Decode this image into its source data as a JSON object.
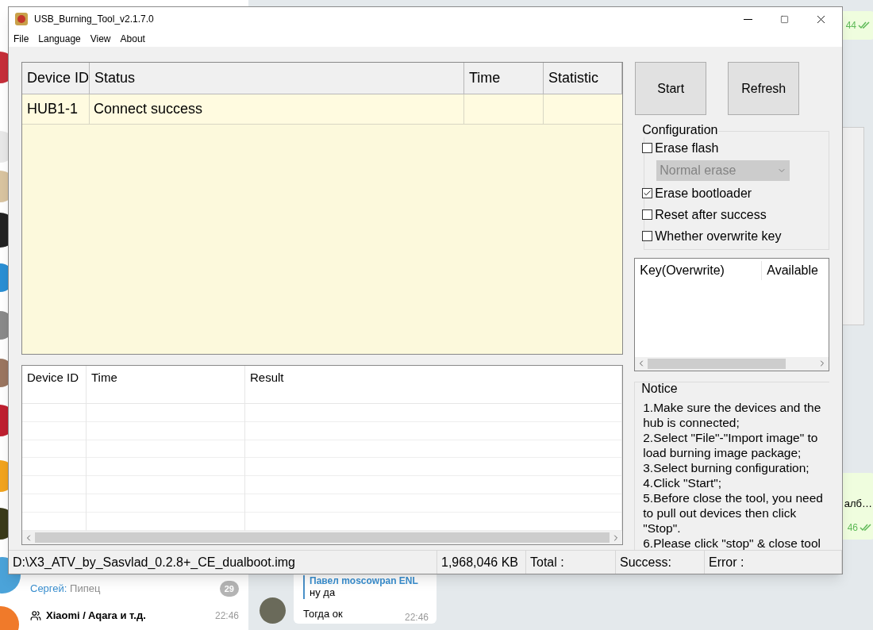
{
  "window": {
    "title": "USB_Burning_Tool_v2.1.7.0"
  },
  "menu": [
    "File",
    "Language",
    "View",
    "About"
  ],
  "device_table": {
    "columns": [
      "Device ID",
      "Status",
      "Time",
      "Statistic"
    ],
    "rows": [
      {
        "device_id": "HUB1-1",
        "status": "Connect success"
      }
    ]
  },
  "result_table": {
    "columns": [
      "Device ID",
      "Time",
      "Result"
    ]
  },
  "buttons": [
    "Start",
    "Refresh"
  ],
  "configuration": {
    "title": "Configuration",
    "options": [
      {
        "kind": "checkbox",
        "label": "Erase flash",
        "checked": false
      },
      {
        "kind": "dropdown",
        "value": "Normal erase",
        "disabled": true
      },
      {
        "kind": "checkbox",
        "label": "Erase bootloader",
        "checked": true
      },
      {
        "kind": "checkbox",
        "label": "Reset after success",
        "checked": false
      },
      {
        "kind": "checkbox",
        "label": "Whether overwrite key",
        "checked": false
      }
    ]
  },
  "key_list": {
    "columns": [
      "Key(Overwrite)",
      "Available"
    ]
  },
  "notice": {
    "title": "Notice",
    "lines": [
      "1.Make sure the devices and the hub is connected;",
      "2.Select \"File\"-\"Import image\" to load burning image package;",
      "3.Select burning configuration;",
      "4.Click \"Start\";",
      "5.Before close the tool, you need to pull out devices then click \"Stop\".",
      "6.Please click \"stop\" & close tool"
    ]
  },
  "status_bar": [
    "D:\\X3_ATV_by_Sasvlad_0.2.8+_CE_dualboot.img",
    "1,968,046 KB",
    "Total :",
    "Success:",
    "Error :"
  ],
  "background": {
    "chats": [
      {
        "sender": "Сергей:",
        "preview": "Пипец",
        "badge": "29"
      },
      {
        "title": "Xiaomi / Aqara и т.д.",
        "time": "22:46"
      }
    ],
    "messages": [
      {
        "kind": "time",
        "time": "44"
      },
      {
        "kind": "snippet",
        "text": "алб…",
        "time": "46"
      },
      {
        "kind": "reply",
        "quote_author": "Павел moscowpan ENL",
        "quote": "ну да",
        "text": "Тогда ок",
        "time": "22:46"
      }
    ]
  }
}
